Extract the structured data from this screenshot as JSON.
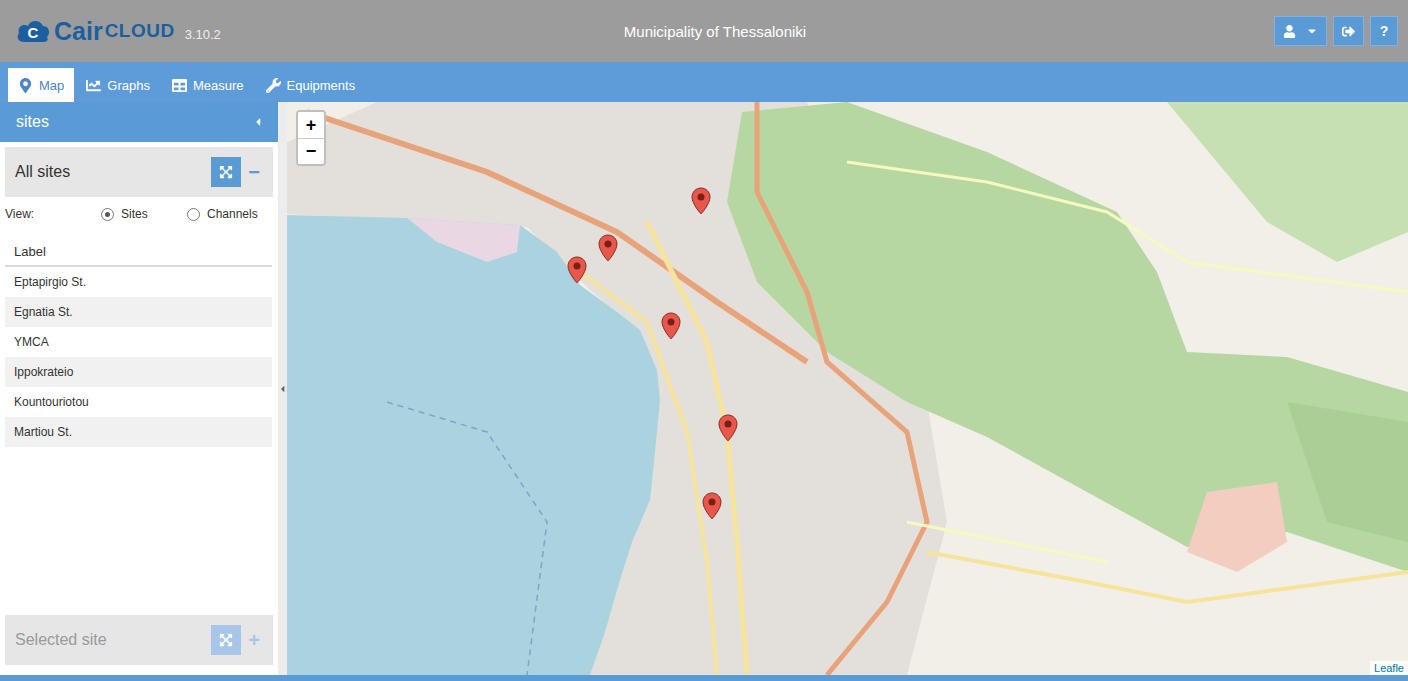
{
  "window": {
    "title": "Municipality of Thessaloniki"
  },
  "logo": {
    "mark": "C",
    "name": "Cair",
    "suffix": "CLOUD",
    "version": "3.10.2"
  },
  "header_buttons": [
    {
      "kind": "user",
      "label": ""
    },
    {
      "kind": "logout",
      "label": ""
    },
    {
      "kind": "help",
      "label": "?"
    }
  ],
  "tabs": [
    {
      "label": "Map",
      "selected": true
    },
    {
      "label": "Graphs",
      "selected": false
    },
    {
      "label": "Measure",
      "selected": false
    },
    {
      "label": "Equipments",
      "selected": false
    }
  ],
  "sidebar": {
    "title": "sites"
  },
  "sites_panel": {
    "title": "All sites",
    "collapse": "−",
    "view_label": "View:",
    "view_options": [
      {
        "label": "Sites",
        "selected": true
      },
      {
        "label": "Channels",
        "selected": false
      }
    ]
  },
  "table": {
    "columns": [
      "Label"
    ],
    "rows": [
      "Eptapirgio St.",
      "Egnatia St.",
      "YMCA",
      "Ippokrateio",
      "Kountouriotou",
      "Martiou St."
    ]
  },
  "selected_panel": {
    "title": "Selected site",
    "add": "+",
    "disabled": true
  },
  "map": {
    "zoom_in": "+",
    "zoom_out": "−",
    "attribution": "Leafle"
  }
}
